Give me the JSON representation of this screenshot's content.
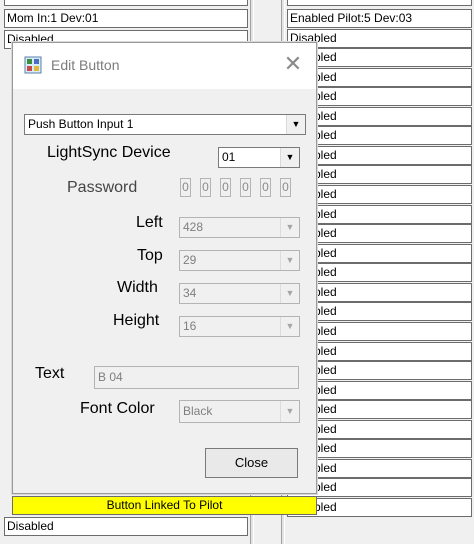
{
  "grid": {
    "left_top_label": "Mom In:1 Dev:01",
    "left_second_label": "Disabled",
    "left_bottom_label": "Disabled",
    "right_cells": [
      "Enabled Pilot:5 Dev:03",
      "Disabled",
      "Disabled",
      "Disabled",
      "Disabled",
      "Disabled",
      "Disabled",
      "Disabled",
      "Disabled",
      "Disabled",
      "Disabled",
      "Disabled",
      "Disabled",
      "Disabled",
      "Disabled",
      "Disabled",
      "Disabled",
      "Disabled",
      "Disabled",
      "Disabled",
      "Disabled",
      "Disabled",
      "Disabled",
      "Disabled",
      "Disabled",
      "Disabled"
    ]
  },
  "dialog": {
    "title": "Edit Button",
    "close_glyph": "✕",
    "input_select": "Push Button Input 1",
    "lightsync_label": "LightSync Device",
    "lightsync_value": "01",
    "password_label": "Password",
    "password_digits": [
      "0",
      "0",
      "0",
      "0",
      "0",
      "0"
    ],
    "left_label": "Left",
    "left_value": "428",
    "top_label": "Top",
    "top_value": "29",
    "width_label": "Width",
    "width_value": "34",
    "height_label": "Height",
    "height_value": "16",
    "text_label": "Text",
    "text_value": "B 04",
    "font_color_label": "Font Color",
    "font_color_value": "Black",
    "close_button": "Close",
    "dropdown_glyph": "▼"
  },
  "status": {
    "linked_text": "Button Linked To Pilot",
    "linked_color": "#ffff00"
  }
}
